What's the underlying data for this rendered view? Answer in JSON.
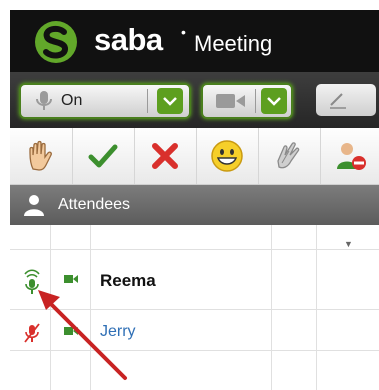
{
  "header": {
    "brand": "saba",
    "brand_mark": "•",
    "product": "Meeting"
  },
  "toolbar": {
    "microphone": {
      "label": "On",
      "icon": "microphone-icon"
    },
    "camera": {
      "icon": "camera-icon"
    },
    "tool": {
      "icon": "pen-icon"
    }
  },
  "actions": [
    {
      "icon": "raise-hand-icon"
    },
    {
      "icon": "checkmark-icon"
    },
    {
      "icon": "cross-icon"
    },
    {
      "icon": "smiley-icon"
    },
    {
      "icon": "applause-icon"
    },
    {
      "icon": "remove-user-icon"
    }
  ],
  "attendees": {
    "title": "Attendees",
    "rows": [
      {
        "name": "Reema",
        "mic": "on",
        "camera": "on"
      },
      {
        "name": "Jerry",
        "mic": "muted",
        "camera": "on"
      }
    ]
  },
  "colors": {
    "accent_green": "#5d9f1f",
    "link_blue": "#2f6fb5",
    "muted_red": "#d9302c",
    "annotation_red": "#c82323"
  }
}
